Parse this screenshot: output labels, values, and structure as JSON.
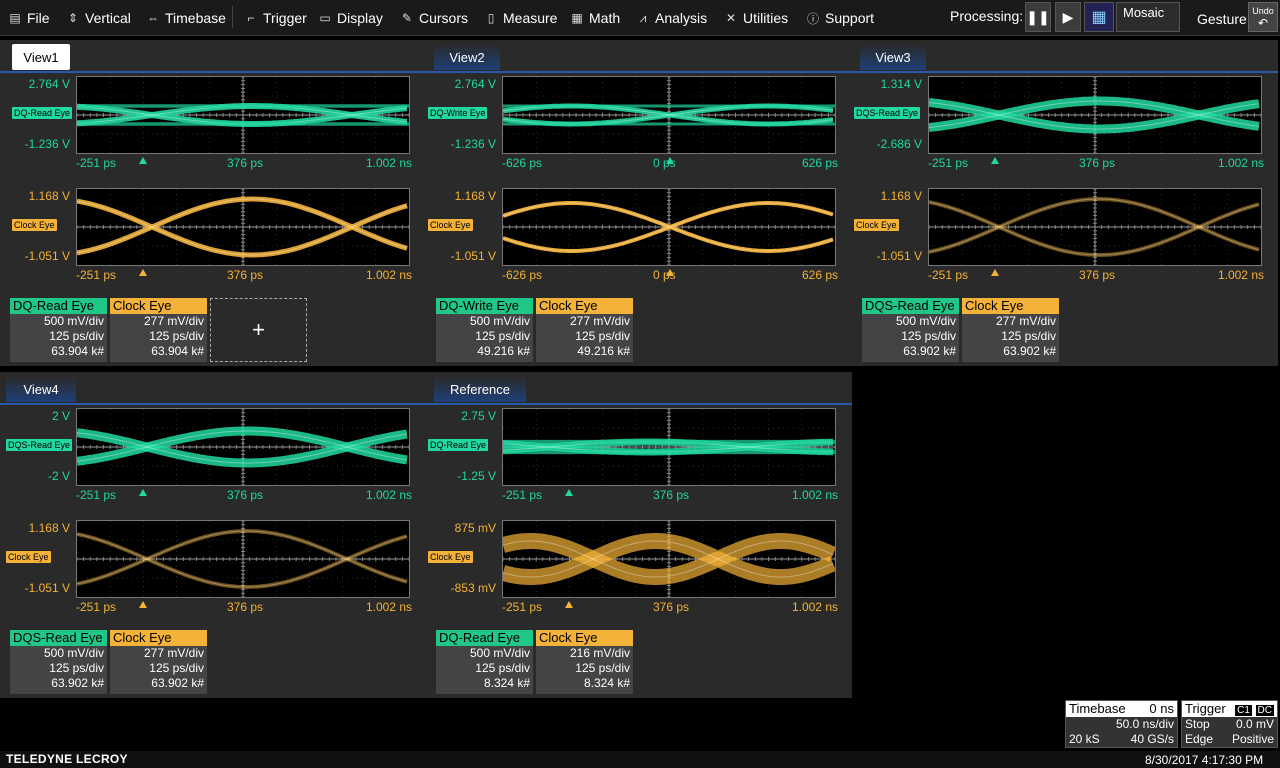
{
  "menu": {
    "file": "File",
    "vertical": "Vertical",
    "timebase": "Timebase",
    "trigger": "Trigger",
    "display": "Display",
    "cursors": "Cursors",
    "measure": "Measure",
    "math": "Math",
    "analysis": "Analysis",
    "utilities": "Utilities",
    "support": "Support",
    "processing": "Processing:",
    "mosaic": "Mosaic",
    "gesture": "Gesture",
    "undo": "Undo"
  },
  "colors": {
    "green": "#20d8a0",
    "orange": "#f4b238",
    "tab_blue": "#2858a8"
  },
  "views": [
    {
      "tab": "View1",
      "top": {
        "ymax": "2.764 V",
        "ymin": "-1.236 V",
        "flag": "DQ-Read Eye",
        "x": [
          "-251 ps",
          "376 ps",
          "1.002 ns"
        ]
      },
      "bottom": {
        "ymax": "1.168 V",
        "ymin": "-1.051 V",
        "flag": "Clock Eye",
        "x": [
          "-251 ps",
          "376 ps",
          "1.002 ns"
        ]
      },
      "desc": [
        {
          "title": "DQ-Read Eye",
          "l1": "500 mV/div",
          "l2": "125 ps/div",
          "l3": "63.904 k#"
        },
        {
          "title": "Clock Eye",
          "l1": "277 mV/div",
          "l2": "125 ps/div",
          "l3": "63.904 k#"
        }
      ],
      "add": "+"
    },
    {
      "tab": "View2",
      "top": {
        "ymax": "2.764 V",
        "ymin": "-1.236 V",
        "flag": "DQ-Write Eye",
        "x": [
          "-626 ps",
          "0 ps",
          "626 ps"
        ]
      },
      "bottom": {
        "ymax": "1.168 V",
        "ymin": "-1.051 V",
        "flag": "Clock Eye",
        "x": [
          "-626 ps",
          "0 ps",
          "626 ps"
        ]
      },
      "desc": [
        {
          "title": "DQ-Write Eye",
          "l1": "500 mV/div",
          "l2": "125 ps/div",
          "l3": "49.216 k#"
        },
        {
          "title": "Clock Eye",
          "l1": "277 mV/div",
          "l2": "125 ps/div",
          "l3": "49.216 k#"
        }
      ]
    },
    {
      "tab": "View3",
      "top": {
        "ymax": "1.314 V",
        "ymin": "-2.686 V",
        "flag": "DQS-Read Eye",
        "x": [
          "-251 ps",
          "376 ps",
          "1.002 ns"
        ]
      },
      "bottom": {
        "ymax": "1.168 V",
        "ymin": "-1.051 V",
        "flag": "Clock Eye",
        "x": [
          "-251 ps",
          "376 ps",
          "1.002 ns"
        ]
      },
      "desc": [
        {
          "title": "DQS-Read Eye",
          "l1": "500 mV/div",
          "l2": "125 ps/div",
          "l3": "63.902 k#"
        },
        {
          "title": "Clock Eye",
          "l1": "277 mV/div",
          "l2": "125 ps/div",
          "l3": "63.902 k#"
        }
      ]
    },
    {
      "tab": "View4",
      "top": {
        "ymax": "2 V",
        "ymin": "-2 V",
        "flag": "DQS-Read Eye",
        "x": [
          "-251 ps",
          "376 ps",
          "1.002 ns"
        ]
      },
      "bottom": {
        "ymax": "1.168 V",
        "ymin": "-1.051 V",
        "flag": "Clock Eye",
        "x": [
          "-251 ps",
          "376 ps",
          "1.002 ns"
        ]
      },
      "desc": [
        {
          "title": "DQS-Read Eye",
          "l1": "500 mV/div",
          "l2": "125 ps/div",
          "l3": "63.902 k#"
        },
        {
          "title": "Clock Eye",
          "l1": "277 mV/div",
          "l2": "125 ps/div",
          "l3": "63.902 k#"
        }
      ]
    },
    {
      "tab": "Reference",
      "top": {
        "ymax": "2.75 V",
        "ymin": "-1.25 V",
        "flag": "DQ-Read Eye",
        "x": [
          "-251 ps",
          "376 ps",
          "1.002 ns"
        ]
      },
      "bottom": {
        "ymax": "875 mV",
        "ymin": "-853 mV",
        "flag": "Clock Eye",
        "x": [
          "-251 ps",
          "376 ps",
          "1.002 ns"
        ]
      },
      "desc": [
        {
          "title": "DQ-Read Eye",
          "l1": "500 mV/div",
          "l2": "125 ps/div",
          "l3": "8.324 k#"
        },
        {
          "title": "Clock Eye",
          "l1": "216 mV/div",
          "l2": "125 ps/div",
          "l3": "8.324 k#"
        }
      ]
    }
  ],
  "timebase": {
    "title": "Timebase",
    "delay": "0 ns",
    "per_div": "50.0 ns/div",
    "samples": "20 kS",
    "rate": "40 GS/s"
  },
  "trigger": {
    "title": "Trigger",
    "ch": "C1",
    "coupling": "DC",
    "mode": "Stop",
    "level": "0.0 mV",
    "type": "Edge",
    "slope": "Positive"
  },
  "footer": {
    "logo": "TELEDYNE LECROY",
    "datetime": "8/30/2017 4:17:30 PM"
  }
}
